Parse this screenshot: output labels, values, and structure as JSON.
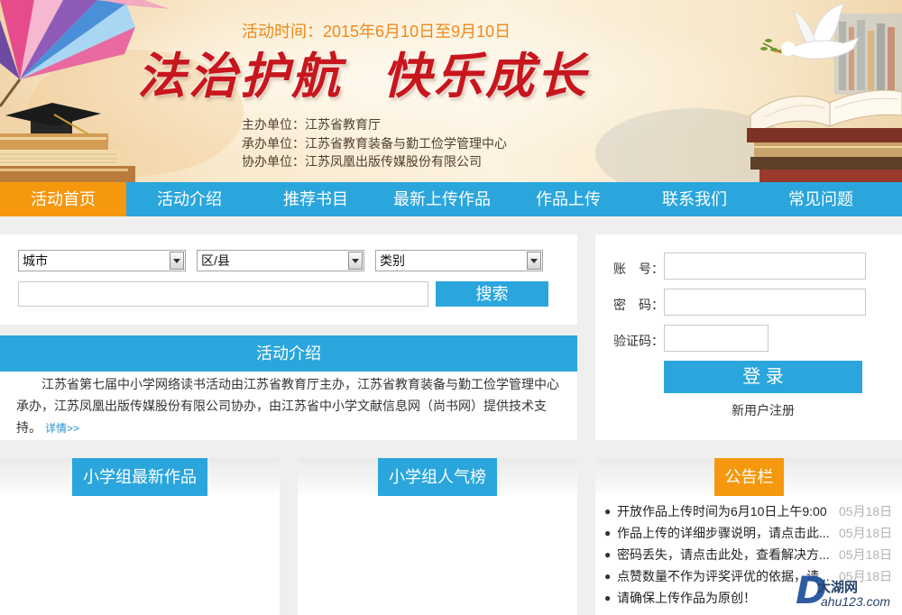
{
  "banner": {
    "time_text": "活动时间：2015年6月10日至9月10日",
    "title_left": "法治护航",
    "title_right": "快乐成长",
    "organizers": [
      "主办单位：江苏省教育厅",
      "承办单位：江苏省教育装备与勤工俭学管理中心",
      "协办单位：江苏凤凰出版传媒股份有限公司"
    ]
  },
  "nav": {
    "active_index": 0,
    "items": [
      "活动首页",
      "活动介绍",
      "推荐书目",
      "最新上传作品",
      "作品上传",
      "联系我们",
      "常见问题"
    ]
  },
  "search": {
    "city_select": "城市",
    "district_select": "区/县",
    "category_select": "类别",
    "keyword_value": "",
    "search_button": "搜索"
  },
  "intro": {
    "title": "活动介绍",
    "text": "江苏省第七届中小学网络读书活动由江苏省教育厅主办，江苏省教育装备与勤工俭学管理中心承办，江苏凤凰出版传媒股份有限公司协办，由江苏省中小学文献信息网（尚书网）提供技术支持。",
    "more_link": "详情>>"
  },
  "login": {
    "account_label": "账　号：",
    "account_value": "",
    "password_label": "密　码：",
    "password_value": "",
    "captcha_label": "验证码：",
    "captcha_value": "",
    "login_button": "登 录",
    "register_link": "新用户注册"
  },
  "panels": {
    "primary_latest_works": {
      "title": "小学组最新作品"
    },
    "primary_popular": {
      "title": "小学组人气榜"
    },
    "notice_board": {
      "title": "公告栏",
      "items": [
        {
          "text": "开放作品上传时间为6月10日上午9:00",
          "date": "05月18日"
        },
        {
          "text": "作品上传的详细步骤说明，请点击此...",
          "date": "05月18日"
        },
        {
          "text": "密码丢失，请点击此处，查看解决方...",
          "date": "05月18日"
        },
        {
          "text": "点赞数量不作为评奖评优的依据，请...",
          "date": "05月18日"
        },
        {
          "text": "请确保上传作品为原创！"
        }
      ]
    }
  },
  "watermark": {
    "logo_letter": "D",
    "name": "大湖网",
    "domain": "ahu123.com"
  },
  "icons": {
    "select_arrow": "chevron-down-icon",
    "notice_bullet": "bullet-icon"
  },
  "colors": {
    "primary_blue": "#2aa6dd",
    "accent_orange": "#f6980e",
    "title_red": "#c8161d",
    "time_orange": "#ee8a1a",
    "page_gray": "#efefef"
  }
}
